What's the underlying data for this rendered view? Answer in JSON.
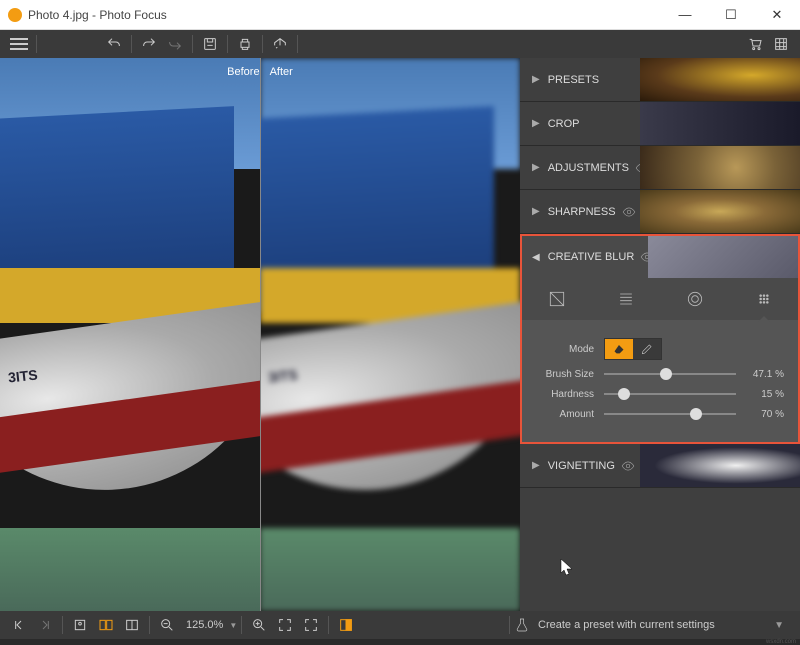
{
  "window": {
    "title": "Photo 4.jpg - Photo Focus"
  },
  "canvas": {
    "before": "Before",
    "after": "After",
    "boat_number": "3ITS"
  },
  "panels": {
    "presets": "PRESETS",
    "crop": "CROP",
    "adjustments": "ADJUSTMENTS",
    "sharpness": "SHARPNESS",
    "creative_blur": "CREATIVE BLUR",
    "vignetting": "VIGNETTING"
  },
  "creative_blur": {
    "mode_label": "Mode",
    "brush_size": {
      "label": "Brush Size",
      "value": 47.1,
      "display": "47.1 %"
    },
    "hardness": {
      "label": "Hardness",
      "value": 15,
      "display": "15 %"
    },
    "amount": {
      "label": "Amount",
      "value": 70,
      "display": "70 %"
    }
  },
  "bottombar": {
    "zoom": "125.0%",
    "preset_cta": "Create a preset with current settings"
  },
  "watermark": "wsxdn.com"
}
